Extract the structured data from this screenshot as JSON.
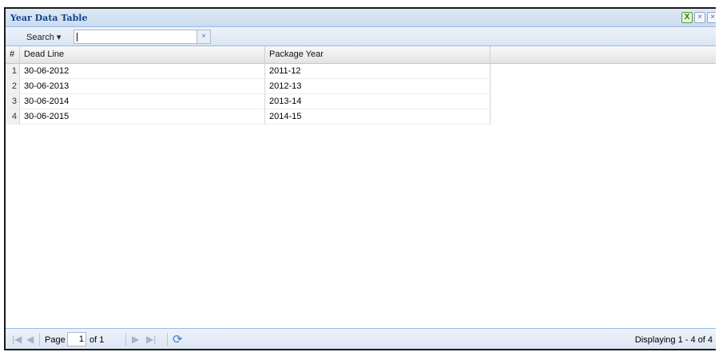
{
  "panel": {
    "title": "Year Data Table",
    "tools": {
      "export_icon": "X",
      "close_1": "×",
      "close_2": "×"
    }
  },
  "toolbar": {
    "search_label": "Search ▾",
    "search_value": "",
    "clear_icon": "×"
  },
  "grid": {
    "columns": {
      "num": "#",
      "dead_line": "Dead Line",
      "package_year": "Package Year"
    },
    "rows": [
      {
        "num": "1",
        "dead_line": "30-06-2012",
        "package_year": "2011-12"
      },
      {
        "num": "2",
        "dead_line": "30-06-2013",
        "package_year": "2012-13"
      },
      {
        "num": "3",
        "dead_line": "30-06-2014",
        "package_year": "2013-14"
      },
      {
        "num": "4",
        "dead_line": "30-06-2015",
        "package_year": "2014-15"
      }
    ]
  },
  "paging": {
    "page_label": "Page",
    "page_value": "1",
    "of_text": "of 1",
    "display_text": "Displaying 1 - 4 of 4",
    "first_icon": "|◀",
    "prev_icon": "◀",
    "next_icon": "▶",
    "last_icon": "▶|",
    "refresh_icon": "⟳"
  },
  "colors": {
    "header_title": "#15428b",
    "header_bg": "#cbdbef",
    "border": "#99bbe8"
  }
}
